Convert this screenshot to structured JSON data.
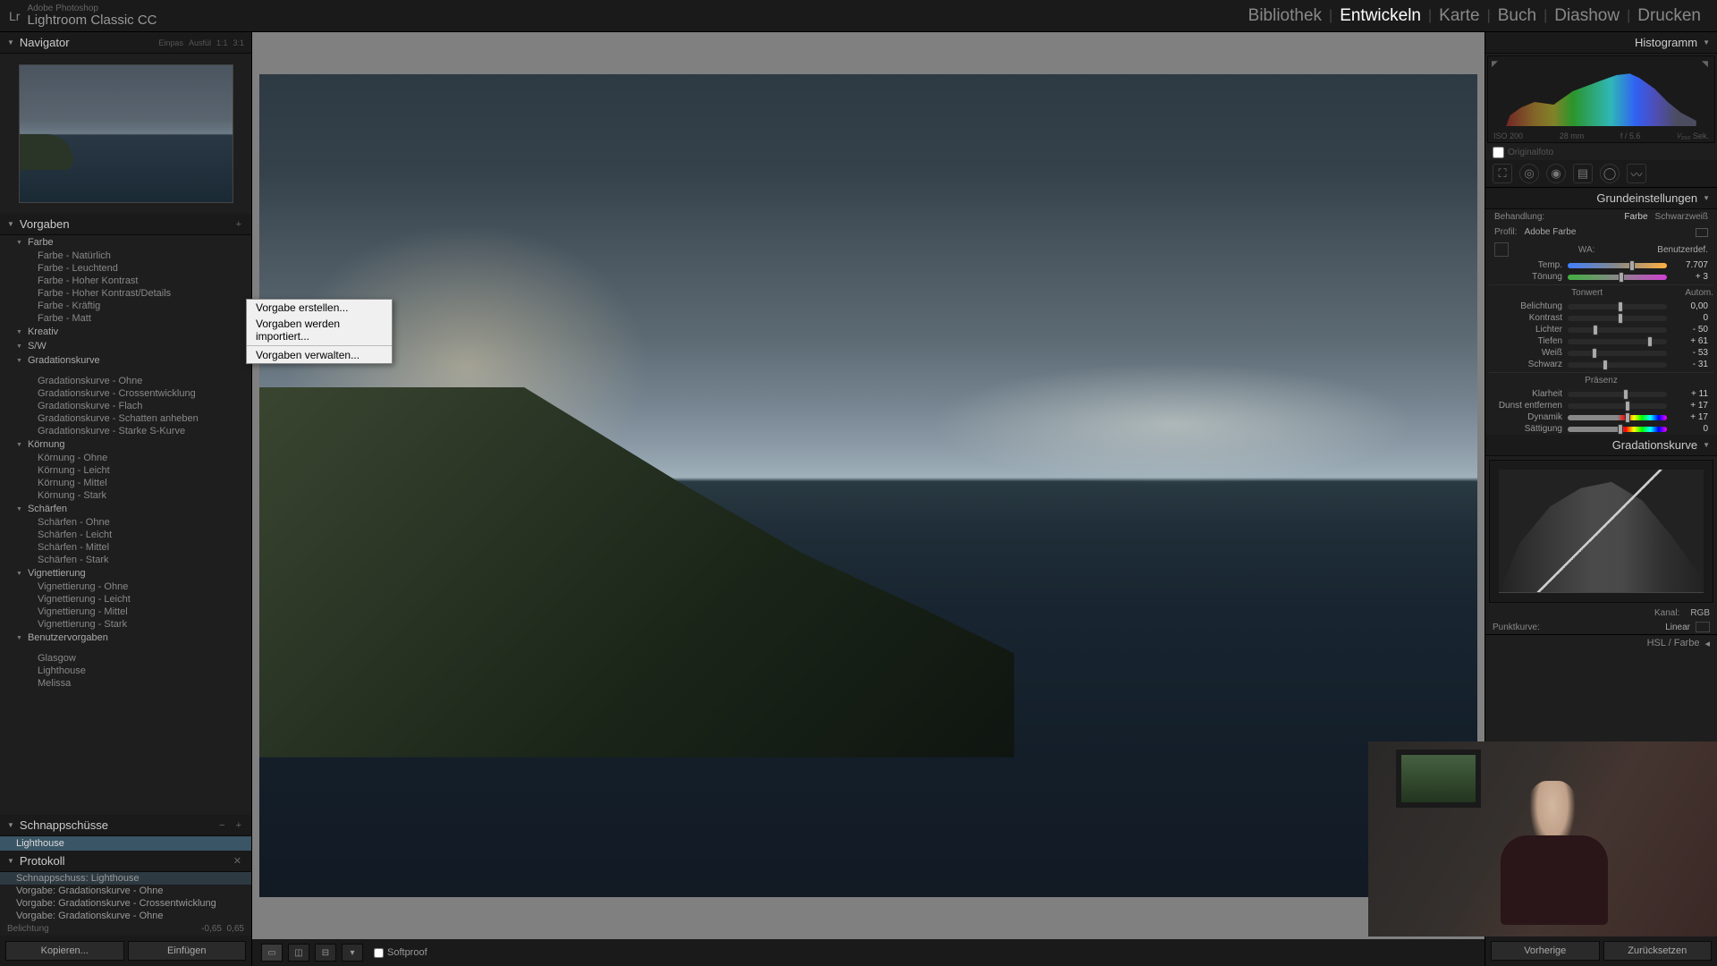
{
  "app": {
    "brand_top": "Adobe Photoshop",
    "brand": "Lightroom Classic CC",
    "logo": "Lr"
  },
  "modules": {
    "library": "Bibliothek",
    "develop": "Entwickeln",
    "map": "Karte",
    "book": "Buch",
    "slideshow": "Diashow",
    "print": "Drucken"
  },
  "navigator": {
    "title": "Navigator",
    "modes": [
      "Einpas",
      "Ausfül",
      "1:1",
      "3:1"
    ]
  },
  "presets": {
    "title": "Vorgaben",
    "groups": [
      {
        "name": "Farbe",
        "items": [
          "Farbe - Natürlich",
          "Farbe - Leuchtend",
          "Farbe - Hoher Kontrast",
          "Farbe - Hoher Kontrast/Details",
          "Farbe - Kräftig",
          "Farbe - Matt"
        ]
      },
      {
        "name": "Kreativ",
        "items": []
      },
      {
        "name": "S/W",
        "items": []
      },
      {
        "name": "Gradationskurve",
        "items": [
          "Gradationskurve - Ohne",
          "Gradationskurve - Crossentwicklung",
          "Gradationskurve - Flach",
          "Gradationskurve - Schatten anheben",
          "Gradationskurve - Starke S-Kurve"
        ]
      },
      {
        "name": "Körnung",
        "items": [
          "Körnung - Ohne",
          "Körnung - Leicht",
          "Körnung - Mittel",
          "Körnung - Stark"
        ]
      },
      {
        "name": "Schärfen",
        "items": [
          "Schärfen - Ohne",
          "Schärfen - Leicht",
          "Schärfen - Mittel",
          "Schärfen - Stark"
        ]
      },
      {
        "name": "Vignettierung",
        "items": [
          "Vignettierung - Ohne",
          "Vignettierung - Leicht",
          "Vignettierung - Mittel",
          "Vignettierung - Stark"
        ]
      },
      {
        "name": "Benutzervorgaben",
        "items": [
          "Glasgow",
          "Lighthouse",
          "Melissa"
        ]
      }
    ]
  },
  "context_menu": {
    "create": "Vorgabe erstellen...",
    "import": "Vorgaben werden importiert...",
    "manage": "Vorgaben verwalten..."
  },
  "snapshots": {
    "title": "Schnappschüsse",
    "items": [
      "Lighthouse"
    ]
  },
  "history": {
    "title": "Protokoll",
    "items": [
      "Schnappschuss: Lighthouse",
      "Vorgabe: Gradationskurve - Ohne",
      "Vorgabe: Gradationskurve - Crossentwicklung",
      "Vorgabe: Gradationskurve - Ohne",
      "Belichtung"
    ],
    "delta_label": "-0,65",
    "delta_val": "0,65"
  },
  "left_buttons": {
    "copy": "Kopieren...",
    "paste": "Einfügen"
  },
  "toolbar": {
    "softproof": "Softproof"
  },
  "histogram": {
    "title": "Histogramm",
    "iso": "ISO 200",
    "focal": "28 mm",
    "aperture": "f / 5.6",
    "shutter": "¹⁄₂₅₀ Sek.",
    "original": "Originalfoto"
  },
  "basic": {
    "title": "Grundeinstellungen",
    "treatment": {
      "label": "Behandlung:",
      "color": "Farbe",
      "bw": "Schwarzweiß"
    },
    "profile": {
      "label": "Profil:",
      "value": "Adobe Farbe"
    },
    "wb": {
      "label": "WA:",
      "value": "Benutzerdef."
    },
    "temp": {
      "label": "Temp.",
      "value": "7.707"
    },
    "tint": {
      "label": "Tönung",
      "value": "+ 3"
    },
    "tone_section": "Tonwert",
    "auto": "Autom.",
    "exposure": {
      "label": "Belichtung",
      "value": "0,00"
    },
    "contrast": {
      "label": "Kontrast",
      "value": "0"
    },
    "highlights": {
      "label": "Lichter",
      "value": "- 50"
    },
    "shadows": {
      "label": "Tiefen",
      "value": "+ 61"
    },
    "whites": {
      "label": "Weiß",
      "value": "- 53"
    },
    "blacks": {
      "label": "Schwarz",
      "value": "- 31"
    },
    "presence_section": "Präsenz",
    "clarity": {
      "label": "Klarheit",
      "value": "+ 11"
    },
    "dehaze": {
      "label": "Dunst entfernen",
      "value": "+ 17"
    },
    "vibrance": {
      "label": "Dynamik",
      "value": "+ 17"
    },
    "saturation": {
      "label": "Sättigung",
      "value": "0"
    }
  },
  "tonecurve": {
    "title": "Gradationskurve",
    "channel_label": "Kanal:",
    "channel": "RGB",
    "pointcurve_label": "Punktkurve:",
    "pointcurve": "Linear"
  },
  "hsl": {
    "title": "HSL / Farbe"
  },
  "right_buttons": {
    "prev": "Vorherige",
    "reset": "Zurücksetzen"
  }
}
